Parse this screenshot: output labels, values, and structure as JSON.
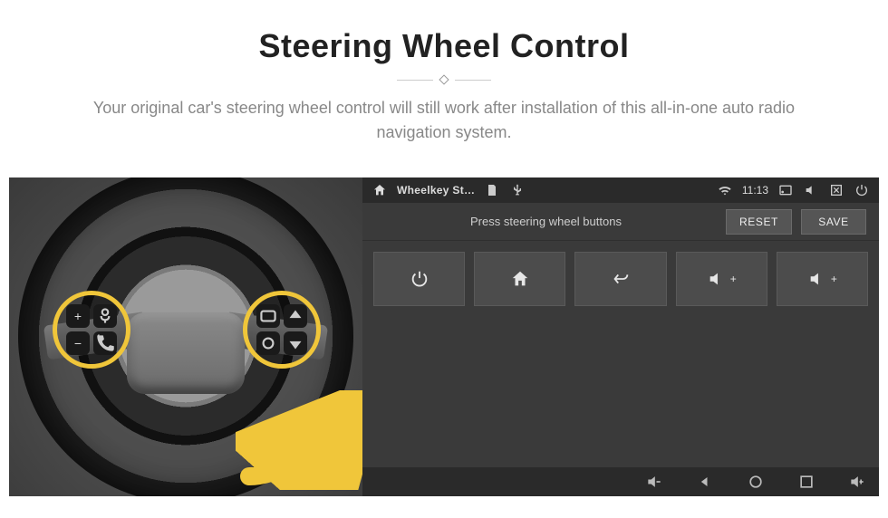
{
  "hero": {
    "title": "Steering Wheel Control",
    "subtitle": "Your original car's steering wheel control will still work after installation of this all-in-one auto radio navigation system."
  },
  "statusbar": {
    "home_icon": "home-icon",
    "app_title": "Wheelkey St…",
    "storage_icon": "sd-icon",
    "usb_icon": "usb-icon",
    "wifi_icon": "wifi-icon",
    "time": "11:13",
    "cast_icon": "cast-icon",
    "mute_icon": "mute-icon",
    "close_icon": "window-close-icon",
    "power_icon": "power-icon"
  },
  "toolbar": {
    "prompt": "Press steering wheel buttons",
    "reset_label": "RESET",
    "save_label": "SAVE"
  },
  "tiles": [
    {
      "name": "power-tile",
      "icon": "power-icon",
      "suffix": ""
    },
    {
      "name": "home-tile",
      "icon": "home-icon",
      "suffix": ""
    },
    {
      "name": "back-tile",
      "icon": "back-icon",
      "suffix": ""
    },
    {
      "name": "vol-up-tile-1",
      "icon": "volume-icon",
      "suffix": "+"
    },
    {
      "name": "vol-up-tile-2",
      "icon": "volume-icon",
      "suffix": "+"
    }
  ],
  "navbar": {
    "vol_down_icon": "volume-down-icon",
    "back_icon": "back-arrow-icon",
    "home_icon": "home-outline-icon",
    "recents_icon": "recents-icon",
    "vol_up_icon": "volume-up-icon"
  },
  "wheel": {
    "left_cluster": [
      "plus-icon",
      "voice-icon",
      "minus-icon",
      "phone-icon"
    ],
    "right_cluster": [
      "mode-icon",
      "up-icon",
      "source-icon",
      "down-icon"
    ]
  },
  "colors": {
    "accent": "#f0c63a",
    "panel": "#3a3a3a",
    "tile": "#4c4c4c"
  }
}
